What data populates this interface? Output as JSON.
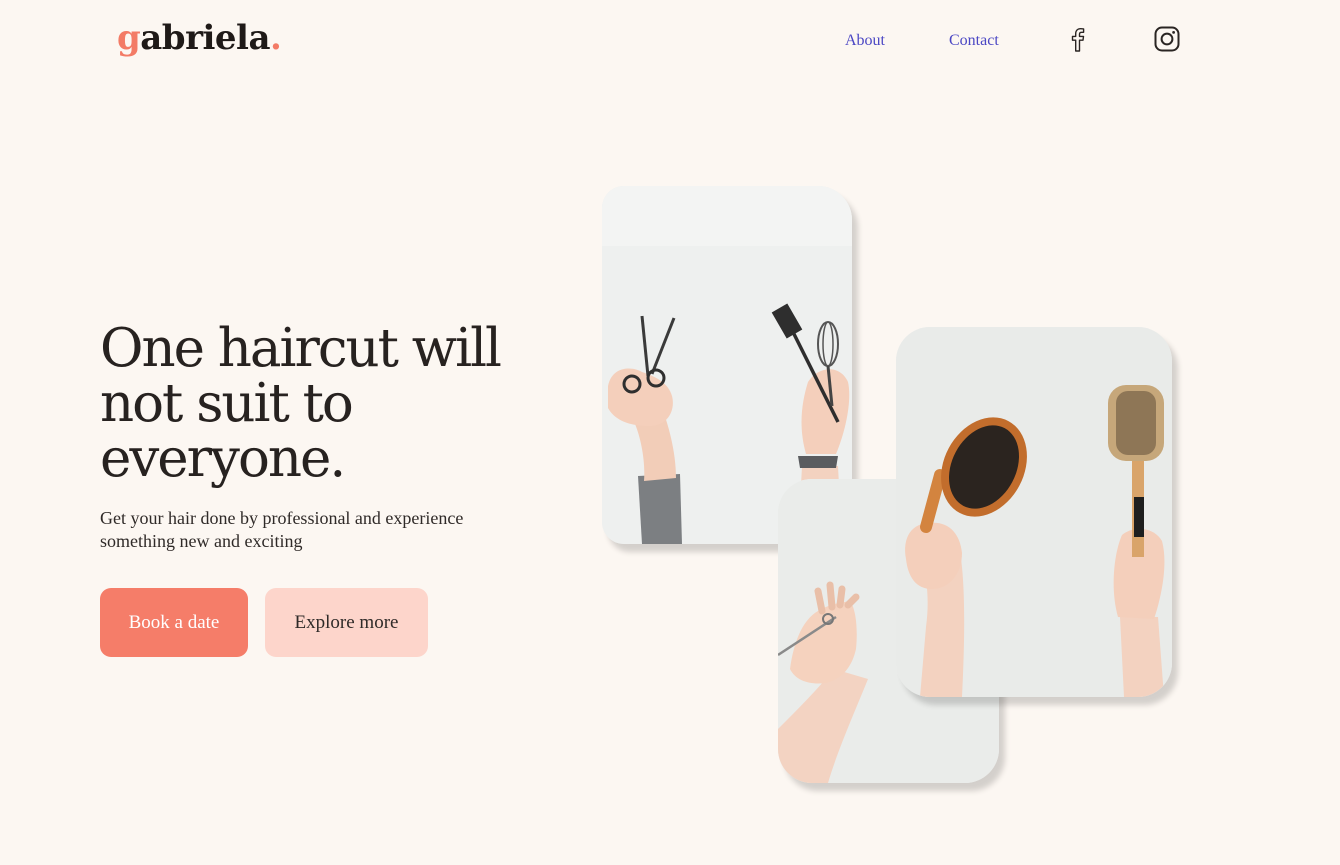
{
  "brand": {
    "first_letter": "g",
    "rest": "abriela",
    "dot": ".",
    "accent_color": "#f37b66"
  },
  "nav": {
    "about": "About",
    "contact": "Contact",
    "facebook_icon": "facebook-icon",
    "instagram_icon": "instagram-icon"
  },
  "hero": {
    "headline": "One haircut will not suit to everyone.",
    "subtext": "Get your hair done by professional and experience something new and exciting",
    "primary_button": "Book a date",
    "secondary_button": "Explore more"
  },
  "images": [
    {
      "name": "hands-holding-scissors-and-brush-photo"
    },
    {
      "name": "hands-holding-hair-brushes-photo"
    },
    {
      "name": "hand-holding-small-scissors-photo"
    }
  ],
  "colors": {
    "background": "#fcf7f2",
    "primary_button": "#f57d69",
    "secondary_button": "#fdd5cb",
    "nav_link": "#4b47c4"
  }
}
